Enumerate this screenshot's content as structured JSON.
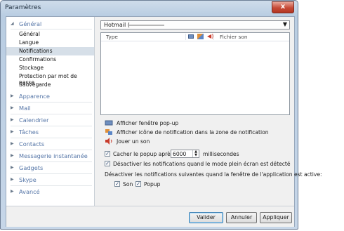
{
  "window": {
    "title": "Paramètres",
    "close_label": "x"
  },
  "sidebar": {
    "expanded_category": {
      "label": "Général",
      "arrow": "◢"
    },
    "subitems": [
      {
        "label": "Général"
      },
      {
        "label": "Langue"
      },
      {
        "label": "Notifications",
        "selected": true
      },
      {
        "label": "Confirmations"
      },
      {
        "label": "Stockage"
      },
      {
        "label": "Protection par mot de passe"
      },
      {
        "label": "Sauvegarde"
      }
    ],
    "categories": [
      {
        "label": "Apparence",
        "arrow": "▶"
      },
      {
        "label": "Mail",
        "arrow": "▶"
      },
      {
        "label": "Calendrier",
        "arrow": "▶"
      },
      {
        "label": "Tâches",
        "arrow": "▶"
      },
      {
        "label": "Contacts",
        "arrow": "▶"
      },
      {
        "label": "Messagerie instantanée",
        "arrow": "▶"
      },
      {
        "label": "Gadgets",
        "arrow": "▶"
      },
      {
        "label": "Skype",
        "arrow": "▶"
      },
      {
        "label": "Avancé",
        "arrow": "▶"
      }
    ]
  },
  "account_select": {
    "value": "Hotmail (",
    "arrow": "▼"
  },
  "list": {
    "col_type": "Type",
    "col_sound": "Fichier son",
    "icons": [
      "popup-icon",
      "tray-notification-icon",
      "sound-icon"
    ]
  },
  "legend": {
    "popup": "Afficher fenêtre pop-up",
    "tray": "Afficher icône de notification dans la zone de notification",
    "sound": "Jouer un son"
  },
  "options": {
    "hide_popup_label": "Cacher le popup après",
    "hide_popup_checked": true,
    "hide_popup_value": "6000",
    "hide_popup_unit": "millisecondes",
    "fullscreen_label": "Désactiver les notifications quand le mode plein écran est détecté",
    "fullscreen_checked": true,
    "active_window_text": "Désactiver les notifications suivantes quand la fenêtre de l'application est active:",
    "sound_label": "Son",
    "sound_checked": true,
    "popup_label": "Popup",
    "popup_checked": true
  },
  "buttons": {
    "ok": "Valider",
    "cancel": "Annuler",
    "apply": "Appliquer"
  },
  "colors": {
    "selection": "#d6dfe8",
    "category_text": "#5777a8",
    "close_button": "#c64a36"
  }
}
